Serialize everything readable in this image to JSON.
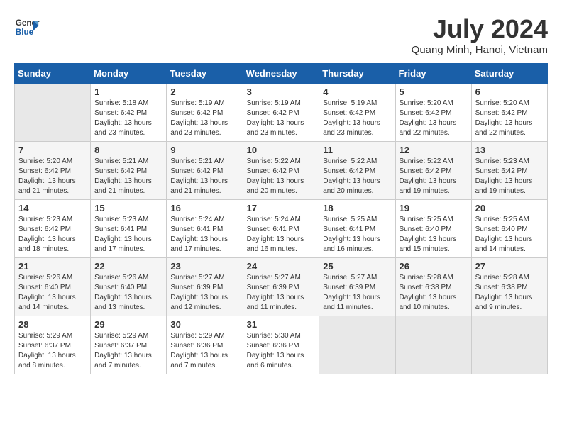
{
  "header": {
    "logo_line1": "General",
    "logo_line2": "Blue",
    "title": "July 2024",
    "subtitle": "Quang Minh, Hanoi, Vietnam"
  },
  "weekdays": [
    "Sunday",
    "Monday",
    "Tuesday",
    "Wednesday",
    "Thursday",
    "Friday",
    "Saturday"
  ],
  "weeks": [
    [
      {
        "num": "",
        "detail": ""
      },
      {
        "num": "1",
        "detail": "Sunrise: 5:18 AM\nSunset: 6:42 PM\nDaylight: 13 hours\nand 23 minutes."
      },
      {
        "num": "2",
        "detail": "Sunrise: 5:19 AM\nSunset: 6:42 PM\nDaylight: 13 hours\nand 23 minutes."
      },
      {
        "num": "3",
        "detail": "Sunrise: 5:19 AM\nSunset: 6:42 PM\nDaylight: 13 hours\nand 23 minutes."
      },
      {
        "num": "4",
        "detail": "Sunrise: 5:19 AM\nSunset: 6:42 PM\nDaylight: 13 hours\nand 23 minutes."
      },
      {
        "num": "5",
        "detail": "Sunrise: 5:20 AM\nSunset: 6:42 PM\nDaylight: 13 hours\nand 22 minutes."
      },
      {
        "num": "6",
        "detail": "Sunrise: 5:20 AM\nSunset: 6:42 PM\nDaylight: 13 hours\nand 22 minutes."
      }
    ],
    [
      {
        "num": "7",
        "detail": "Sunrise: 5:20 AM\nSunset: 6:42 PM\nDaylight: 13 hours\nand 21 minutes."
      },
      {
        "num": "8",
        "detail": "Sunrise: 5:21 AM\nSunset: 6:42 PM\nDaylight: 13 hours\nand 21 minutes."
      },
      {
        "num": "9",
        "detail": "Sunrise: 5:21 AM\nSunset: 6:42 PM\nDaylight: 13 hours\nand 21 minutes."
      },
      {
        "num": "10",
        "detail": "Sunrise: 5:22 AM\nSunset: 6:42 PM\nDaylight: 13 hours\nand 20 minutes."
      },
      {
        "num": "11",
        "detail": "Sunrise: 5:22 AM\nSunset: 6:42 PM\nDaylight: 13 hours\nand 20 minutes."
      },
      {
        "num": "12",
        "detail": "Sunrise: 5:22 AM\nSunset: 6:42 PM\nDaylight: 13 hours\nand 19 minutes."
      },
      {
        "num": "13",
        "detail": "Sunrise: 5:23 AM\nSunset: 6:42 PM\nDaylight: 13 hours\nand 19 minutes."
      }
    ],
    [
      {
        "num": "14",
        "detail": "Sunrise: 5:23 AM\nSunset: 6:42 PM\nDaylight: 13 hours\nand 18 minutes."
      },
      {
        "num": "15",
        "detail": "Sunrise: 5:23 AM\nSunset: 6:41 PM\nDaylight: 13 hours\nand 17 minutes."
      },
      {
        "num": "16",
        "detail": "Sunrise: 5:24 AM\nSunset: 6:41 PM\nDaylight: 13 hours\nand 17 minutes."
      },
      {
        "num": "17",
        "detail": "Sunrise: 5:24 AM\nSunset: 6:41 PM\nDaylight: 13 hours\nand 16 minutes."
      },
      {
        "num": "18",
        "detail": "Sunrise: 5:25 AM\nSunset: 6:41 PM\nDaylight: 13 hours\nand 16 minutes."
      },
      {
        "num": "19",
        "detail": "Sunrise: 5:25 AM\nSunset: 6:40 PM\nDaylight: 13 hours\nand 15 minutes."
      },
      {
        "num": "20",
        "detail": "Sunrise: 5:25 AM\nSunset: 6:40 PM\nDaylight: 13 hours\nand 14 minutes."
      }
    ],
    [
      {
        "num": "21",
        "detail": "Sunrise: 5:26 AM\nSunset: 6:40 PM\nDaylight: 13 hours\nand 14 minutes."
      },
      {
        "num": "22",
        "detail": "Sunrise: 5:26 AM\nSunset: 6:40 PM\nDaylight: 13 hours\nand 13 minutes."
      },
      {
        "num": "23",
        "detail": "Sunrise: 5:27 AM\nSunset: 6:39 PM\nDaylight: 13 hours\nand 12 minutes."
      },
      {
        "num": "24",
        "detail": "Sunrise: 5:27 AM\nSunset: 6:39 PM\nDaylight: 13 hours\nand 11 minutes."
      },
      {
        "num": "25",
        "detail": "Sunrise: 5:27 AM\nSunset: 6:39 PM\nDaylight: 13 hours\nand 11 minutes."
      },
      {
        "num": "26",
        "detail": "Sunrise: 5:28 AM\nSunset: 6:38 PM\nDaylight: 13 hours\nand 10 minutes."
      },
      {
        "num": "27",
        "detail": "Sunrise: 5:28 AM\nSunset: 6:38 PM\nDaylight: 13 hours\nand 9 minutes."
      }
    ],
    [
      {
        "num": "28",
        "detail": "Sunrise: 5:29 AM\nSunset: 6:37 PM\nDaylight: 13 hours\nand 8 minutes."
      },
      {
        "num": "29",
        "detail": "Sunrise: 5:29 AM\nSunset: 6:37 PM\nDaylight: 13 hours\nand 7 minutes."
      },
      {
        "num": "30",
        "detail": "Sunrise: 5:29 AM\nSunset: 6:36 PM\nDaylight: 13 hours\nand 7 minutes."
      },
      {
        "num": "31",
        "detail": "Sunrise: 5:30 AM\nSunset: 6:36 PM\nDaylight: 13 hours\nand 6 minutes."
      },
      {
        "num": "",
        "detail": ""
      },
      {
        "num": "",
        "detail": ""
      },
      {
        "num": "",
        "detail": ""
      }
    ]
  ]
}
